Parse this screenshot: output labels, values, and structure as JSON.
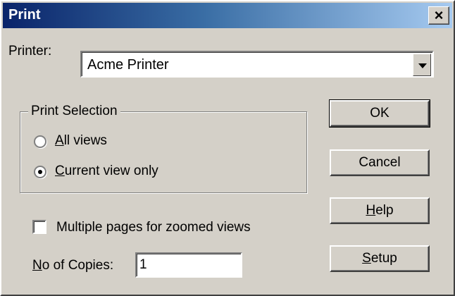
{
  "window": {
    "title": "Print",
    "close_symbol": "✕"
  },
  "printer": {
    "label": "Printer:",
    "selected": "Acme Printer"
  },
  "print_selection": {
    "title": "Print Selection",
    "options": [
      {
        "label_mnemonic": "A",
        "label_rest": "ll views",
        "checked": false
      },
      {
        "label_mnemonic": "C",
        "label_rest": "urrent view only",
        "checked": true
      }
    ]
  },
  "multiple_pages": {
    "label": "Multiple pages for zoomed views",
    "checked": false
  },
  "copies": {
    "label_mnemonic": "N",
    "label_rest": "o of Copies:",
    "value": "1"
  },
  "buttons": {
    "ok": "OK",
    "cancel": "Cancel",
    "help_mnemonic": "H",
    "help_rest": "elp",
    "setup_mnemonic": "S",
    "setup_rest": "etup"
  }
}
